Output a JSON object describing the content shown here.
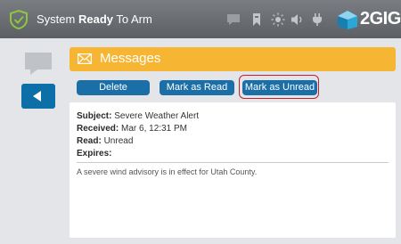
{
  "header": {
    "title_prefix": "System ",
    "title_bold": "Ready",
    "title_suffix": " To Arm",
    "logo_text": "2GIG",
    "icons": [
      "chat-icon",
      "bookmark-icon",
      "brightness-icon",
      "volume-icon",
      "power-plug-icon"
    ]
  },
  "sidebar": {
    "chat_icon": "chat-icon",
    "back_icon": "back-arrow-icon"
  },
  "messages": {
    "title": "Messages",
    "buttons": {
      "delete": "Delete",
      "mark_read": "Mark as Read",
      "mark_unread": "Mark as Unread"
    },
    "detail": {
      "subject_label": "Subject:",
      "subject": "Severe Weather Alert",
      "received_label": "Received:",
      "received": "Mar 6, 12:31 PM",
      "read_label": "Read:",
      "read": "Unread",
      "expires_label": "Expires:",
      "expires": "",
      "body": "A severe wind advisory is in effect for Utah County."
    }
  },
  "colors": {
    "topbar": "#6b6e72",
    "accent_yellow": "#f6b634",
    "button_blue": "#1b6fa6",
    "highlight_red": "#c81e2c",
    "status_green": "#8dc63f"
  }
}
